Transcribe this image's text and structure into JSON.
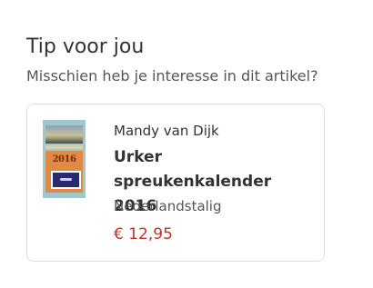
{
  "section": {
    "title": "Tip voor jou",
    "subtitle": "Misschien heb je interesse in dit artikel?"
  },
  "product": {
    "author": "Mandy van Dijk",
    "title": "Urker spreukenkalender 2016",
    "language": "Nederlandstalig",
    "price": "€ 12,95",
    "cover_year": "2016",
    "price_color": "#c0332b"
  }
}
